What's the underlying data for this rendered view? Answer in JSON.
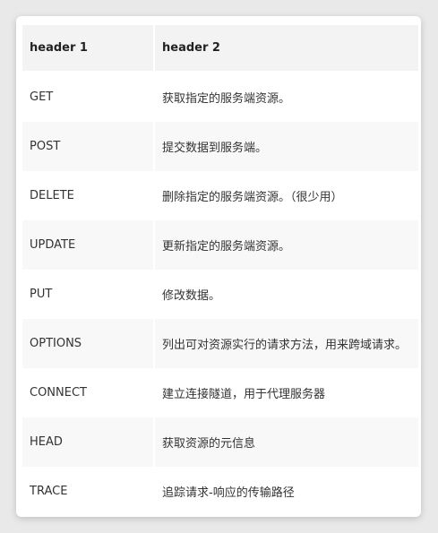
{
  "table": {
    "headers": [
      "header 1",
      "header 2"
    ],
    "rows": [
      [
        "GET",
        "获取指定的服务端资源。"
      ],
      [
        "POST",
        "提交数据到服务端。"
      ],
      [
        "DELETE",
        "删除指定的服务端资源。（很少用）"
      ],
      [
        "UPDATE",
        "更新指定的服务端资源。"
      ],
      [
        "PUT",
        "修改数据。"
      ],
      [
        "OPTIONS",
        "列出可对资源实行的请求方法，用来跨域请求。"
      ],
      [
        "CONNECT",
        "建立连接隧道，用于代理服务器"
      ],
      [
        "HEAD",
        "获取资源的元信息"
      ],
      [
        "TRACE",
        "追踪请求-响应的传输路径"
      ]
    ]
  },
  "colors": {
    "header_bg": "#f3f3f3",
    "row_alt_bg": "#f8f8f8",
    "text": "#333333"
  }
}
